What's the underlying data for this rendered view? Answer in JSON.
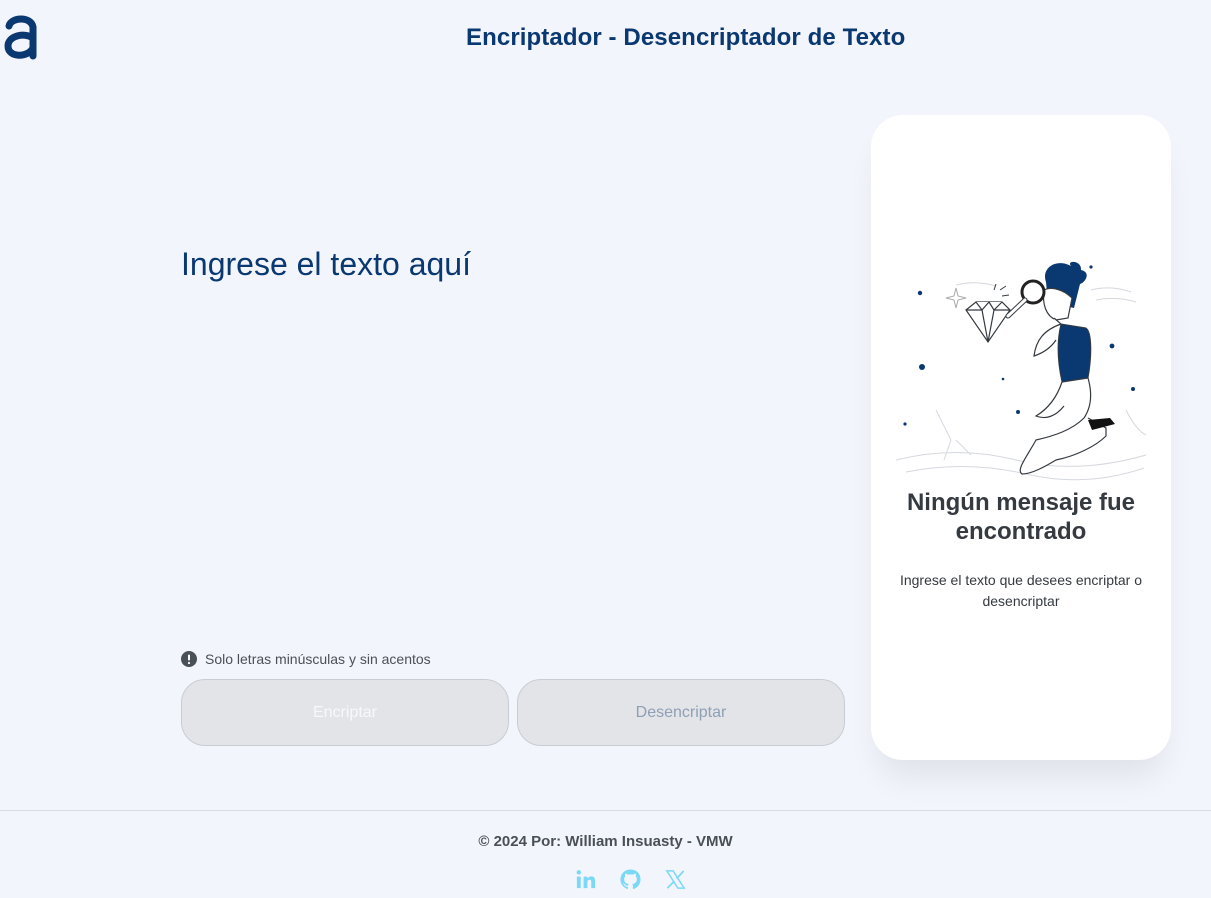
{
  "header": {
    "logo_icon": "alura-logo-icon",
    "title": "Encriptador - Desencriptador de Texto"
  },
  "input": {
    "placeholder": "Ingrese el texto aquí",
    "value": ""
  },
  "hint": {
    "icon": "exclamation-circle-icon",
    "text": "Solo letras minúsculas y sin acentos"
  },
  "buttons": {
    "encrypt_label": "Encriptar",
    "decrypt_label": "Desencriptar"
  },
  "output_card": {
    "illustration": "person-with-magnifying-glass-illustration",
    "title": "Ningún mensaje fue encontrado",
    "text": "Ingrese el texto que desees encriptar o desencriptar"
  },
  "footer": {
    "credit": "© 2024 Por: William Insuasty - VMW",
    "social_icons": [
      "linkedin-icon",
      "github-icon",
      "x-icon"
    ]
  },
  "colors": {
    "primary": "#0a3871",
    "background": "#f3f5fc",
    "social": "#7cd9f5"
  }
}
